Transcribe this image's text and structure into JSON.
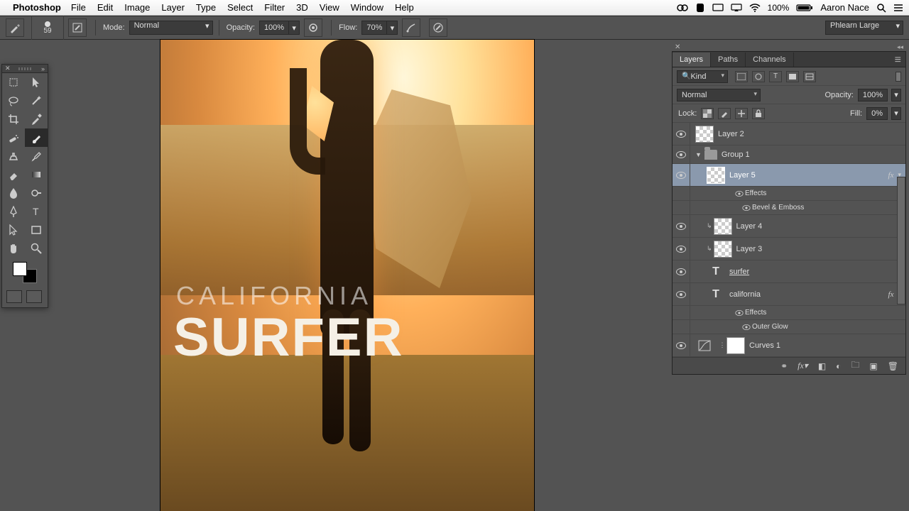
{
  "mac": {
    "app": "Photoshop",
    "menus": [
      "File",
      "Edit",
      "Image",
      "Layer",
      "Type",
      "Select",
      "Filter",
      "3D",
      "View",
      "Window",
      "Help"
    ],
    "battery": "100%",
    "user": "Aaron Nace"
  },
  "options": {
    "brush_size": "59",
    "mode_label": "Mode:",
    "mode_value": "Normal",
    "opacity_label": "Opacity:",
    "opacity_value": "100%",
    "flow_label": "Flow:",
    "flow_value": "70%",
    "workspace": "Phlearn Large"
  },
  "canvas": {
    "text_small": "CALIFORNIA",
    "text_big": "SURFER"
  },
  "panel": {
    "tabs": [
      "Layers",
      "Paths",
      "Channels"
    ],
    "active_tab": "Layers",
    "filter_kind": "Kind",
    "blend_mode": "Normal",
    "opacity_label": "Opacity:",
    "opacity_value": "100%",
    "lock_label": "Lock:",
    "fill_label": "Fill:",
    "fill_value": "0%",
    "layers": {
      "layer2": "Layer 2",
      "group1": "Group 1",
      "layer5": "Layer 5",
      "effects": "Effects",
      "bevel": "Bevel & Emboss",
      "layer4": "Layer 4",
      "layer3": "Layer 3",
      "surfer": "surfer",
      "california": "california",
      "outer_glow": "Outer Glow",
      "curves1": "Curves 1"
    }
  }
}
